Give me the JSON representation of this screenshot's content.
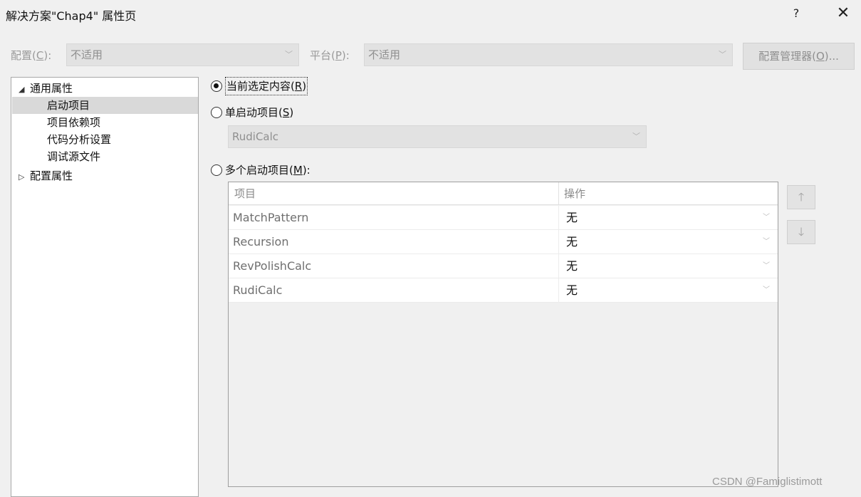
{
  "window": {
    "title": "解决方案\"Chap4\" 属性页",
    "help_label": "?",
    "close_label": "✕"
  },
  "config": {
    "label": "配置(",
    "label_key": "C",
    "label_end": "):",
    "value": "不适用",
    "platform_label": "平台(",
    "platform_key": "P",
    "platform_end": "):",
    "platform_value": "不适用",
    "manager_label": "配置管理器(",
    "manager_key": "O",
    "manager_end": ")..."
  },
  "tree": {
    "items": [
      {
        "label": "通用属性",
        "arrow": "◢"
      },
      {
        "label": "启动项目"
      },
      {
        "label": "项目依赖项"
      },
      {
        "label": "代码分析设置"
      },
      {
        "label": "调试源文件"
      },
      {
        "label": "配置属性",
        "arrow": "▷"
      }
    ]
  },
  "startup": {
    "current_selection": {
      "label": "当前选定内容(",
      "key": "R",
      "end": ")"
    },
    "single": {
      "label": "单启动项目(",
      "key": "S",
      "end": ")"
    },
    "single_value": "RudiCalc",
    "multiple": {
      "label": "多个启动项目(",
      "key": "M",
      "end": "):"
    },
    "selected_option": "current_selection"
  },
  "grid": {
    "columns": [
      "项目",
      "操作"
    ],
    "rows": [
      {
        "project": "MatchPattern",
        "action": "无"
      },
      {
        "project": "Recursion",
        "action": "无"
      },
      {
        "project": "RevPolishCalc",
        "action": "无"
      },
      {
        "project": "RudiCalc",
        "action": "无"
      }
    ]
  },
  "buttons": {
    "move_up": "🡑",
    "move_down": "🡓"
  },
  "watermark": "CSDN @Famiglistimott"
}
